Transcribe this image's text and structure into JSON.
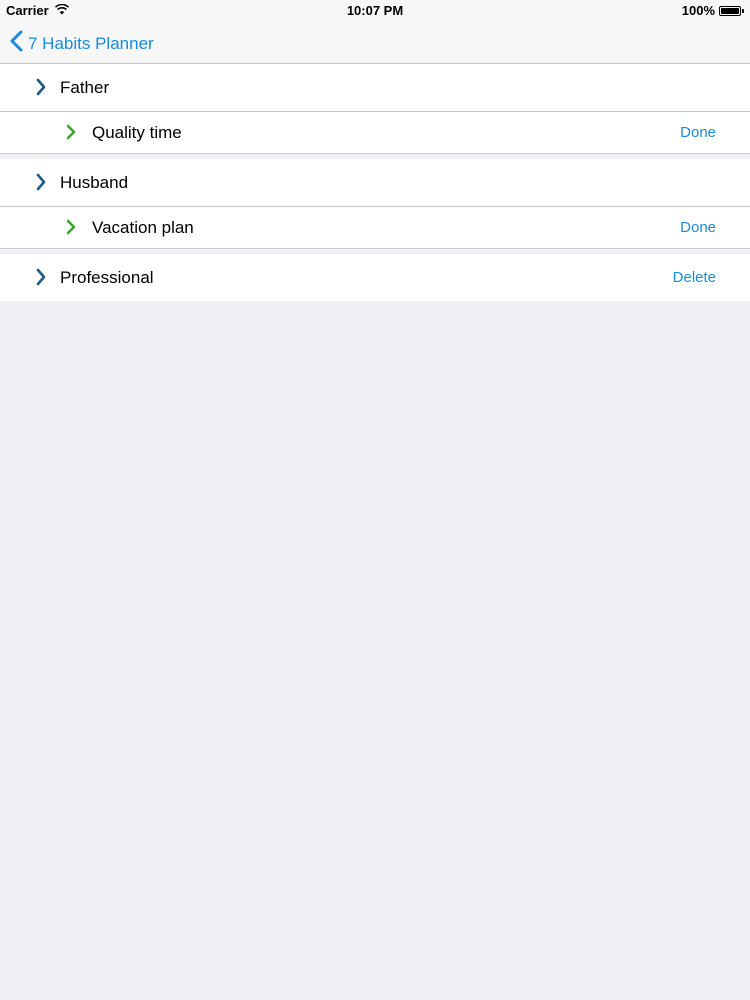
{
  "status_bar": {
    "carrier": "Carrier",
    "time": "10:07 PM",
    "battery": "100%",
    "battery_level": 1.0,
    "wifi_icon": "wifi-icon",
    "battery_icon": "battery-icon"
  },
  "nav": {
    "back_label": "7 Habits Planner",
    "back_icon": "chevron-left-icon"
  },
  "colors": {
    "accent": "#1a8adb",
    "parent_chevron": "#1d5a86",
    "child_chevron": "#3aa530",
    "background": "#efeff4"
  },
  "rows": [
    {
      "type": "parent",
      "label": "Father",
      "action": ""
    },
    {
      "type": "child",
      "label": "Quality time",
      "action": "Done"
    },
    {
      "type": "parent",
      "label": "Husband",
      "action": ""
    },
    {
      "type": "child",
      "label": "Vacation plan",
      "action": "Done"
    },
    {
      "type": "parent",
      "label": "Professional",
      "action": "Delete"
    }
  ]
}
